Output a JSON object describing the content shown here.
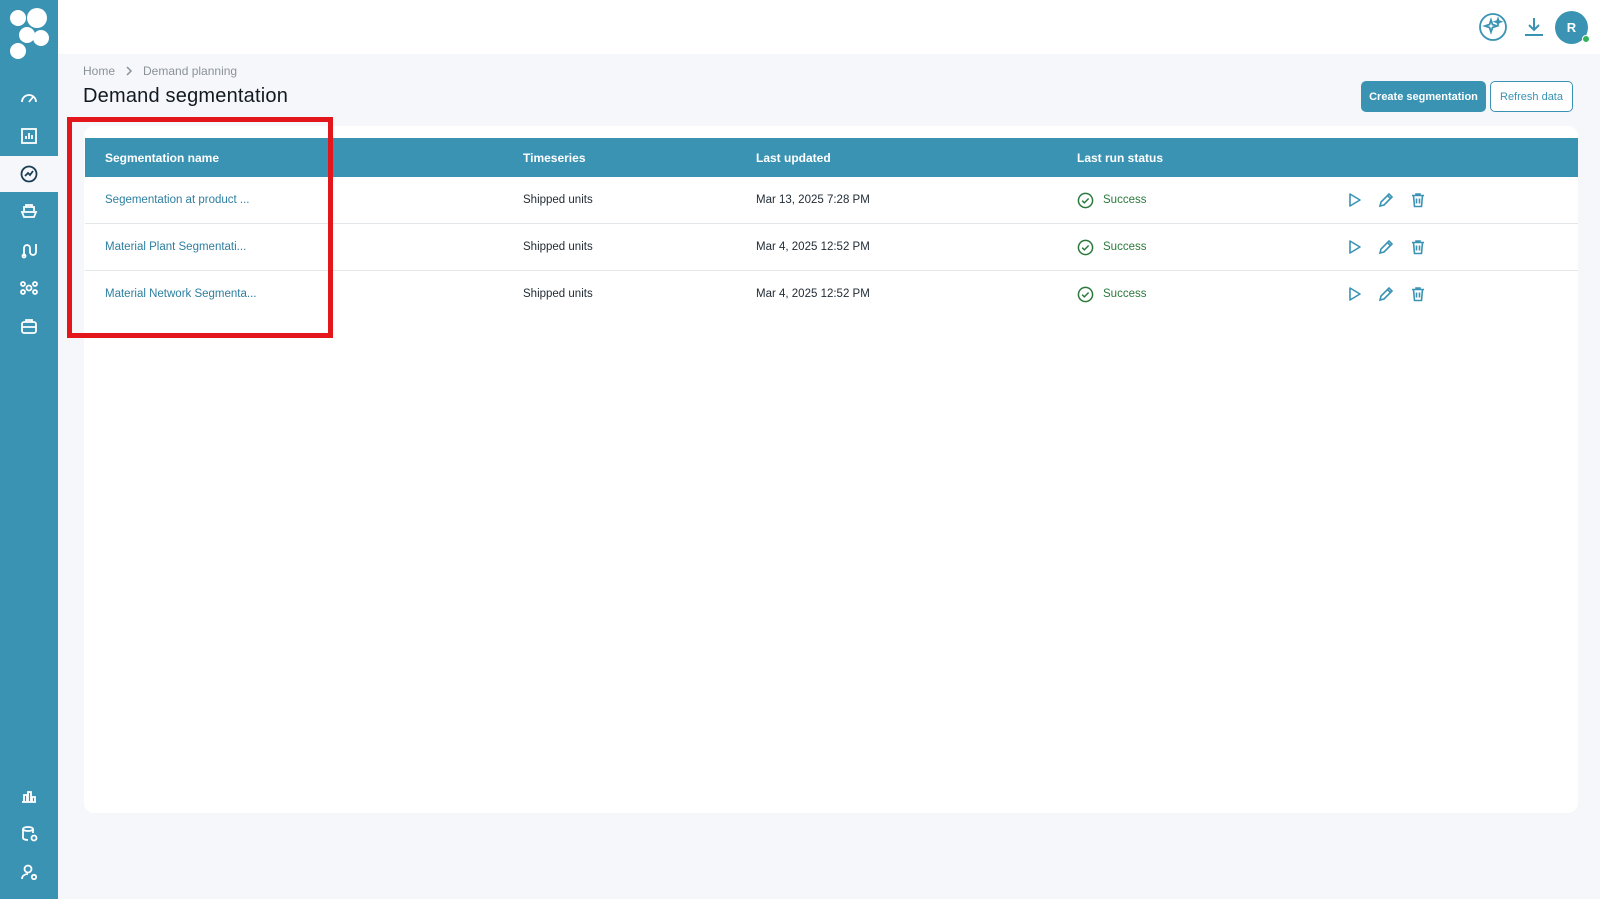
{
  "sidebar": {
    "icons": [
      "logo-icon",
      "dashboard-icon",
      "bar-chart-icon",
      "trend-icon",
      "ship-icon",
      "route-icon",
      "network-icon",
      "briefcase-icon",
      "reports-icon",
      "database-settings-icon",
      "user-settings-icon"
    ]
  },
  "header": {
    "icons": [
      "ai-sparkle-icon",
      "download-icon"
    ],
    "avatar_initial": "R"
  },
  "breadcrumb": {
    "items": [
      "Home",
      "Demand planning"
    ]
  },
  "page": {
    "title": "Demand segmentation",
    "create_button": "Create segmentation",
    "refresh_button": "Refresh data"
  },
  "table": {
    "columns": [
      "Segmentation name",
      "Timeseries",
      "Last updated",
      "Last run status"
    ],
    "rows": [
      {
        "name": "Segementation at product ...",
        "timeseries": "Shipped units",
        "updated": "Mar 13, 2025 7:28 PM",
        "status": "Success"
      },
      {
        "name": "Material Plant Segmentati...",
        "timeseries": "Shipped units",
        "updated": "Mar 4, 2025 12:52 PM",
        "status": "Success"
      },
      {
        "name": "Material Network Segmenta...",
        "timeseries": "Shipped units",
        "updated": "Mar 4, 2025 12:52 PM",
        "status": "Success"
      }
    ]
  },
  "colors": {
    "accent": "#3b93b4",
    "success": "#2b7a3c",
    "highlight": "#e3161b"
  }
}
